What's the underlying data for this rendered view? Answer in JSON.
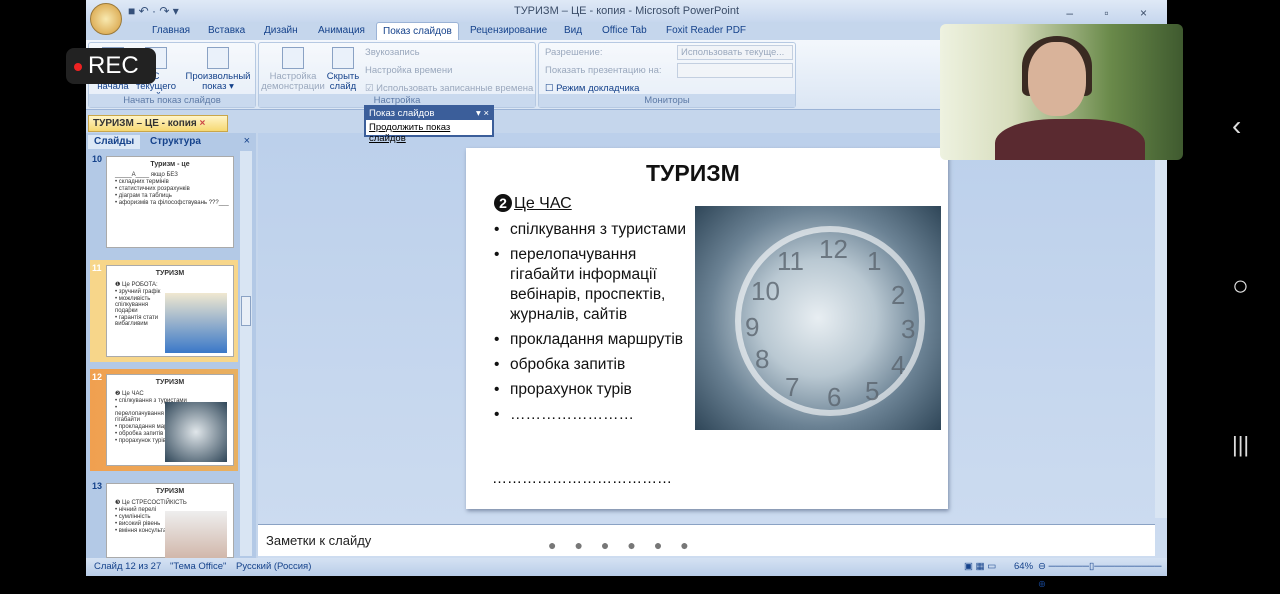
{
  "window": {
    "title": "ТУРИЗМ – ЦЕ - копия - Microsoft PowerPoint",
    "controls": "– ▫ ×"
  },
  "tabs": [
    "Главная",
    "Вставка",
    "Дизайн",
    "Анимация",
    "Показ слайдов",
    "Рецензирование",
    "Вид",
    "Office Tab",
    "Foxit Reader PDF"
  ],
  "ribbon": {
    "start_group": {
      "label": "Начать показ слайдов",
      "from_start": "С начала",
      "from_current": "С текущего слайда",
      "custom": "Произвольный показ ▾"
    },
    "setup_group": {
      "label": "Настройка",
      "setup": "Настройка демонстрации",
      "hide": "Скрыть слайд",
      "record": "Звукозапись",
      "timing": "Настройка времени",
      "use_timings": "Использовать записанные времена"
    },
    "monitors_group": {
      "label": "Мониторы",
      "resolution": "Разрешение:",
      "resolution_value": "Использовать текуще...",
      "show_on": "Показать презентацию на:",
      "presenter": "Режим докладчика"
    }
  },
  "float_toolbar": {
    "title": "Показ слайдов",
    "item": "Продолжить показ слайдов"
  },
  "doc_tab": "ТУРИЗМ – ЦЕ - копия",
  "panel": {
    "tabs": [
      "Слайды",
      "Структура"
    ],
    "thumbs": [
      {
        "num": "10",
        "title": "Туризм - це",
        "lines": [
          "_____А____ якщо БЕЗ",
          "• складних термінів",
          "• статистичних розрахунків",
          "• діаграм та таблиць",
          "• афоризмів та філософствувань ???___"
        ]
      },
      {
        "num": "11",
        "title": "ТУРИЗМ",
        "lines": [
          "❶ Це РОБОТА:",
          "• зручний графік",
          "• можливість спілкування подарки",
          "• гарантія стати вибагливим"
        ]
      },
      {
        "num": "12",
        "title": "ТУРИЗМ",
        "lines": [
          "❷ Це ЧАС",
          "• спілкування з туристами",
          "• перелопачування гігабайти",
          "• прокладання маршрутів",
          "• обробка запитів",
          "• прорахунок турів"
        ]
      },
      {
        "num": "13",
        "title": "ТУРИЗМ",
        "lines": [
          "❸ Це СТРЕСОСТІЙКІСТЬ",
          "• нічний перелі",
          "• сумлінність",
          "• високий рівень",
          "• вміння консультації"
        ]
      }
    ]
  },
  "slide": {
    "title": "ТУРИЗМ",
    "number": "2",
    "subtitle": "Це ЧАС",
    "bullets": [
      "спілкування з туристами",
      "перелопачування гігабайти інформації вебінарів, проспектів, журналів, сайтів",
      "прокладання маршрутів",
      "обробка запитів",
      "прорахунок турів",
      "……………………"
    ],
    "trailing": "………………………………",
    "clock_numbers": [
      "12",
      "1",
      "2",
      "3",
      "4",
      "5",
      "6",
      "7",
      "8",
      "9",
      "10",
      "11"
    ]
  },
  "notes": {
    "placeholder": "Заметки к слайду"
  },
  "status": {
    "slide": "Слайд 12 из 27",
    "theme": "\"Тема Office\"",
    "lang": "Русский (Россия)",
    "zoom": "64%"
  },
  "overlay": {
    "rec": "REC"
  },
  "android_nav": {
    "back": "‹",
    "home": "○",
    "recents": "|||"
  }
}
